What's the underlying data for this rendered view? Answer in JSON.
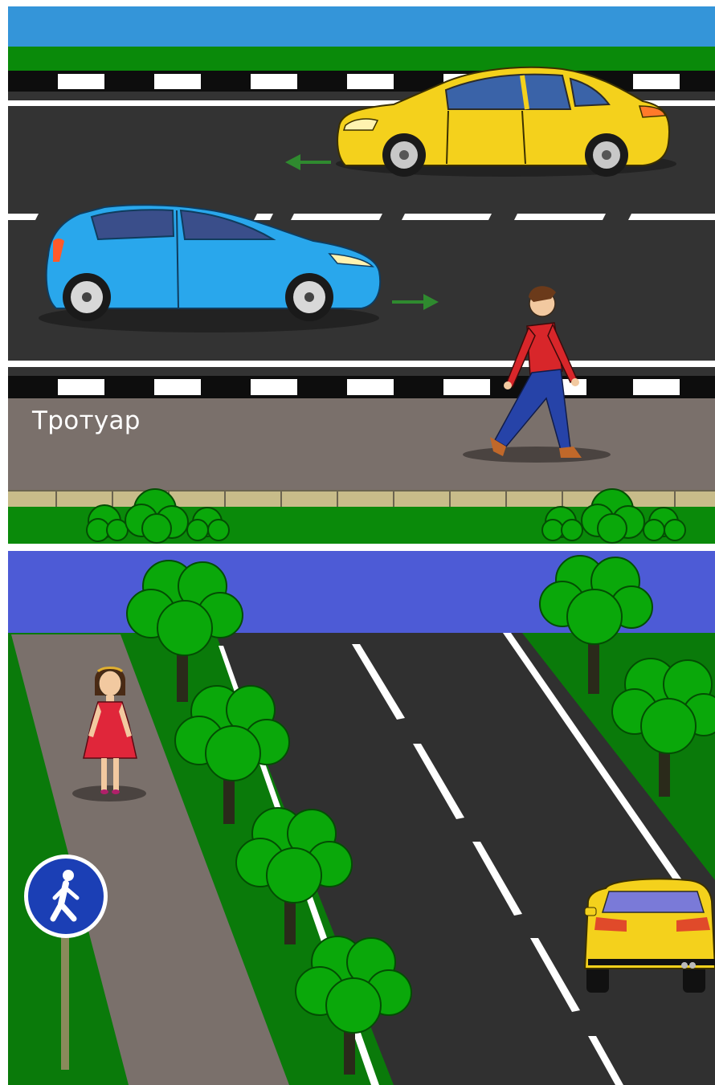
{
  "top_scene": {
    "sidewalk_label": "Тротуар",
    "colors": {
      "sky": "#3495d9",
      "grass": "#0a8a0a",
      "road": "#333333",
      "sidewalk": "#7a706b",
      "curb": "#c8bc8a",
      "car_yellow": "#f4d11c",
      "car_blue": "#29a7ec",
      "arrow": "#2f8a2f",
      "pedestrian_shirt": "#d8262a",
      "pedestrian_jeans": "#2643a8"
    },
    "arrows": [
      "left",
      "right"
    ]
  },
  "bottom_scene": {
    "colors": {
      "sky": "#4d5bd6",
      "grass": "#0a7a0a",
      "tree": "#0aa80a",
      "road": "#303030",
      "path": "#7a706b",
      "dress": "#e0263a",
      "sign": "#1b3fb5"
    },
    "sign_icon": "pedestrian-icon"
  }
}
